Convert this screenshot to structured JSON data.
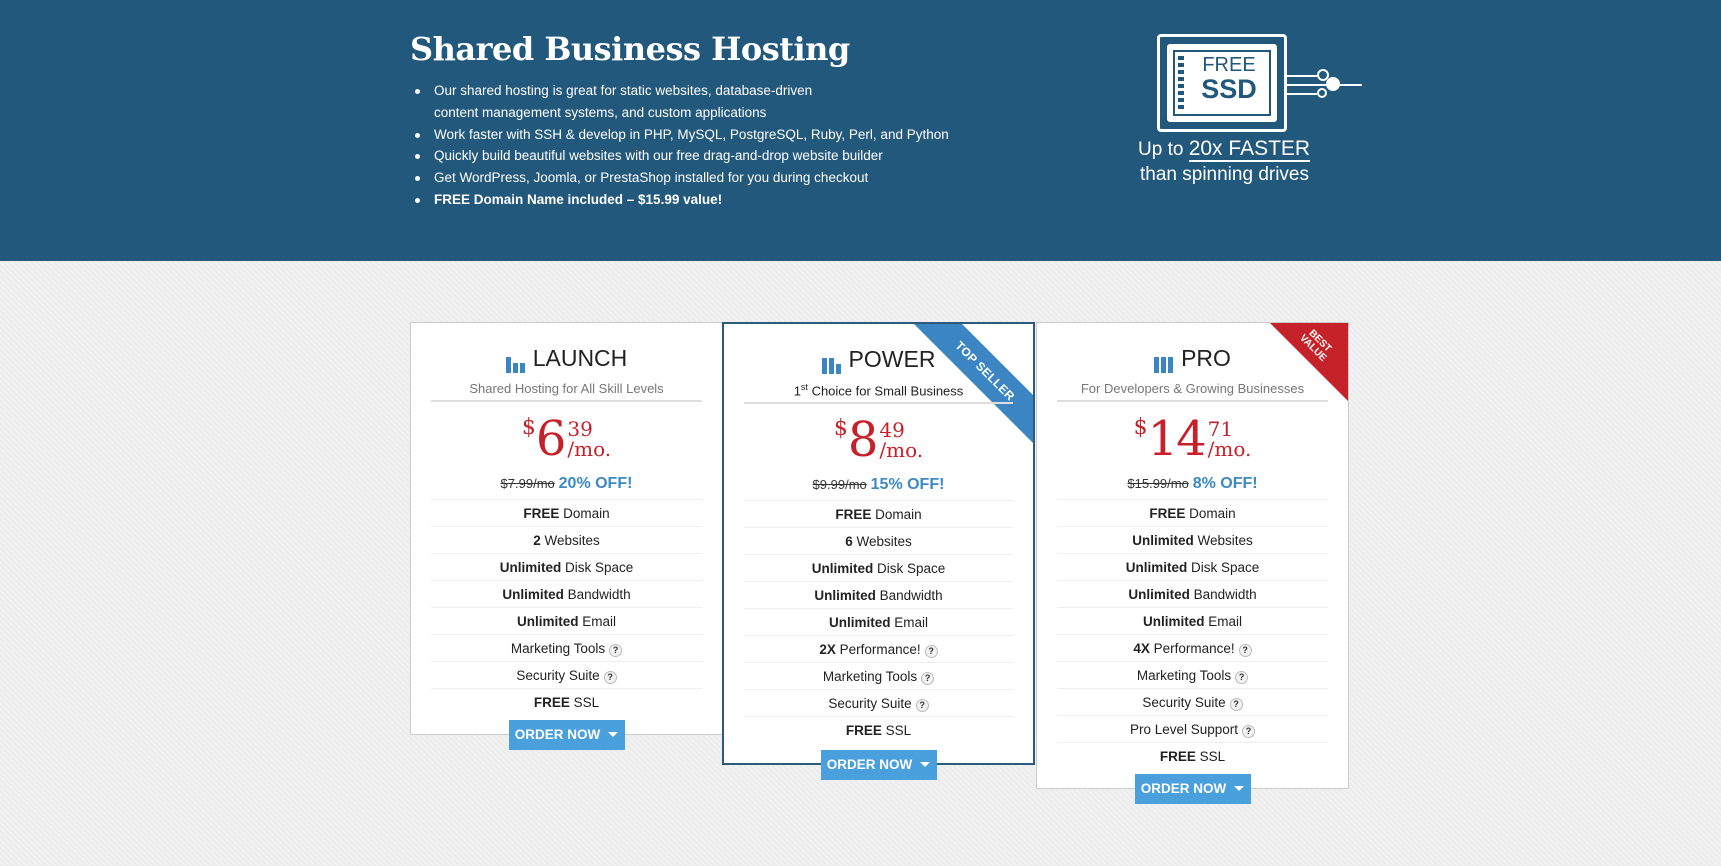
{
  "hero": {
    "title": "Shared Business Hosting",
    "bullets": [
      "Our shared hosting is great for static websites, database-driven",
      "content management systems, and custom applications",
      "Work faster with SSH & develop in PHP, MySQL, PostgreSQL, Ruby, Perl, and Python",
      "Quickly build beautiful websites with our free drag-and-drop website builder",
      "Get WordPress, Joomla, or PrestaShop installed for you during checkout",
      "FREE Domain Name included – $15.99 value!"
    ],
    "ssd": {
      "free": "FREE",
      "ssd": "SSD",
      "line1_prefix": "Up to",
      "line1_highlight": "20x FASTER",
      "line2": "than spinning drives"
    }
  },
  "colors": {
    "hero_bg": "#22587b",
    "price": "#c6202a",
    "accent_blue": "#3b8ac4",
    "button": "#4a9fdd",
    "best_value": "#c52229"
  },
  "plans": [
    {
      "name": "LAUNCH",
      "icon": "bars-1-icon",
      "subtitle": "Shared Hosting for All Skill Levels",
      "currency": "$",
      "price_whole": "6",
      "price_cents": "39",
      "per": "/mo.",
      "old_price": "$7.99/mo",
      "discount": "20% OFF!",
      "features": [
        {
          "bold": "FREE",
          "text": "Domain"
        },
        {
          "bold": "2",
          "text": "Websites"
        },
        {
          "bold": "Unlimited",
          "text": "Disk Space"
        },
        {
          "bold": "Unlimited",
          "text": "Bandwidth"
        },
        {
          "bold": "Unlimited",
          "text": "Email"
        },
        {
          "bold": "",
          "text": "Marketing Tools",
          "help": "?"
        },
        {
          "bold": "",
          "text": "Security Suite",
          "help": "?"
        },
        {
          "bold": "FREE",
          "text": "SSL"
        }
      ],
      "button": "ORDER NOW"
    },
    {
      "name": "POWER",
      "icon": "bars-2-icon",
      "subtitle_pre": "1",
      "subtitle_sup": "st",
      "subtitle": "Choice for Small Business",
      "currency": "$",
      "price_whole": "8",
      "price_cents": "49",
      "per": "/mo.",
      "old_price": "$9.99/mo",
      "discount": "15% OFF!",
      "ribbon": "TOP SELLER",
      "features": [
        {
          "bold": "FREE",
          "text": "Domain"
        },
        {
          "bold": "6",
          "text": "Websites"
        },
        {
          "bold": "Unlimited",
          "text": "Disk Space"
        },
        {
          "bold": "Unlimited",
          "text": "Bandwidth"
        },
        {
          "bold": "Unlimited",
          "text": "Email"
        },
        {
          "bold": "2X",
          "text": "Performance!",
          "help": "?"
        },
        {
          "bold": "",
          "text": "Marketing Tools",
          "help": "?"
        },
        {
          "bold": "",
          "text": "Security Suite",
          "help": "?"
        },
        {
          "bold": "FREE",
          "text": "SSL"
        }
      ],
      "button": "ORDER NOW"
    },
    {
      "name": "PRO",
      "icon": "bars-3-icon",
      "subtitle": "For Developers & Growing Businesses",
      "currency": "$",
      "price_whole": "14",
      "price_cents": "71",
      "per": "/mo.",
      "old_price": "$15.99/mo",
      "discount": "8% OFF!",
      "ribbon": "BEST VALUE",
      "features": [
        {
          "bold": "FREE",
          "text": "Domain"
        },
        {
          "bold": "Unlimited",
          "text": "Websites"
        },
        {
          "bold": "Unlimited",
          "text": "Disk Space"
        },
        {
          "bold": "Unlimited",
          "text": "Bandwidth"
        },
        {
          "bold": "Unlimited",
          "text": "Email"
        },
        {
          "bold": "4X",
          "text": "Performance!",
          "help": "?"
        },
        {
          "bold": "",
          "text": "Marketing Tools",
          "help": "?"
        },
        {
          "bold": "",
          "text": "Security Suite",
          "help": "?"
        },
        {
          "bold": "",
          "text": "Pro Level Support",
          "help": "?"
        },
        {
          "bold": "FREE",
          "text": "SSL"
        }
      ],
      "button": "ORDER NOW"
    }
  ]
}
